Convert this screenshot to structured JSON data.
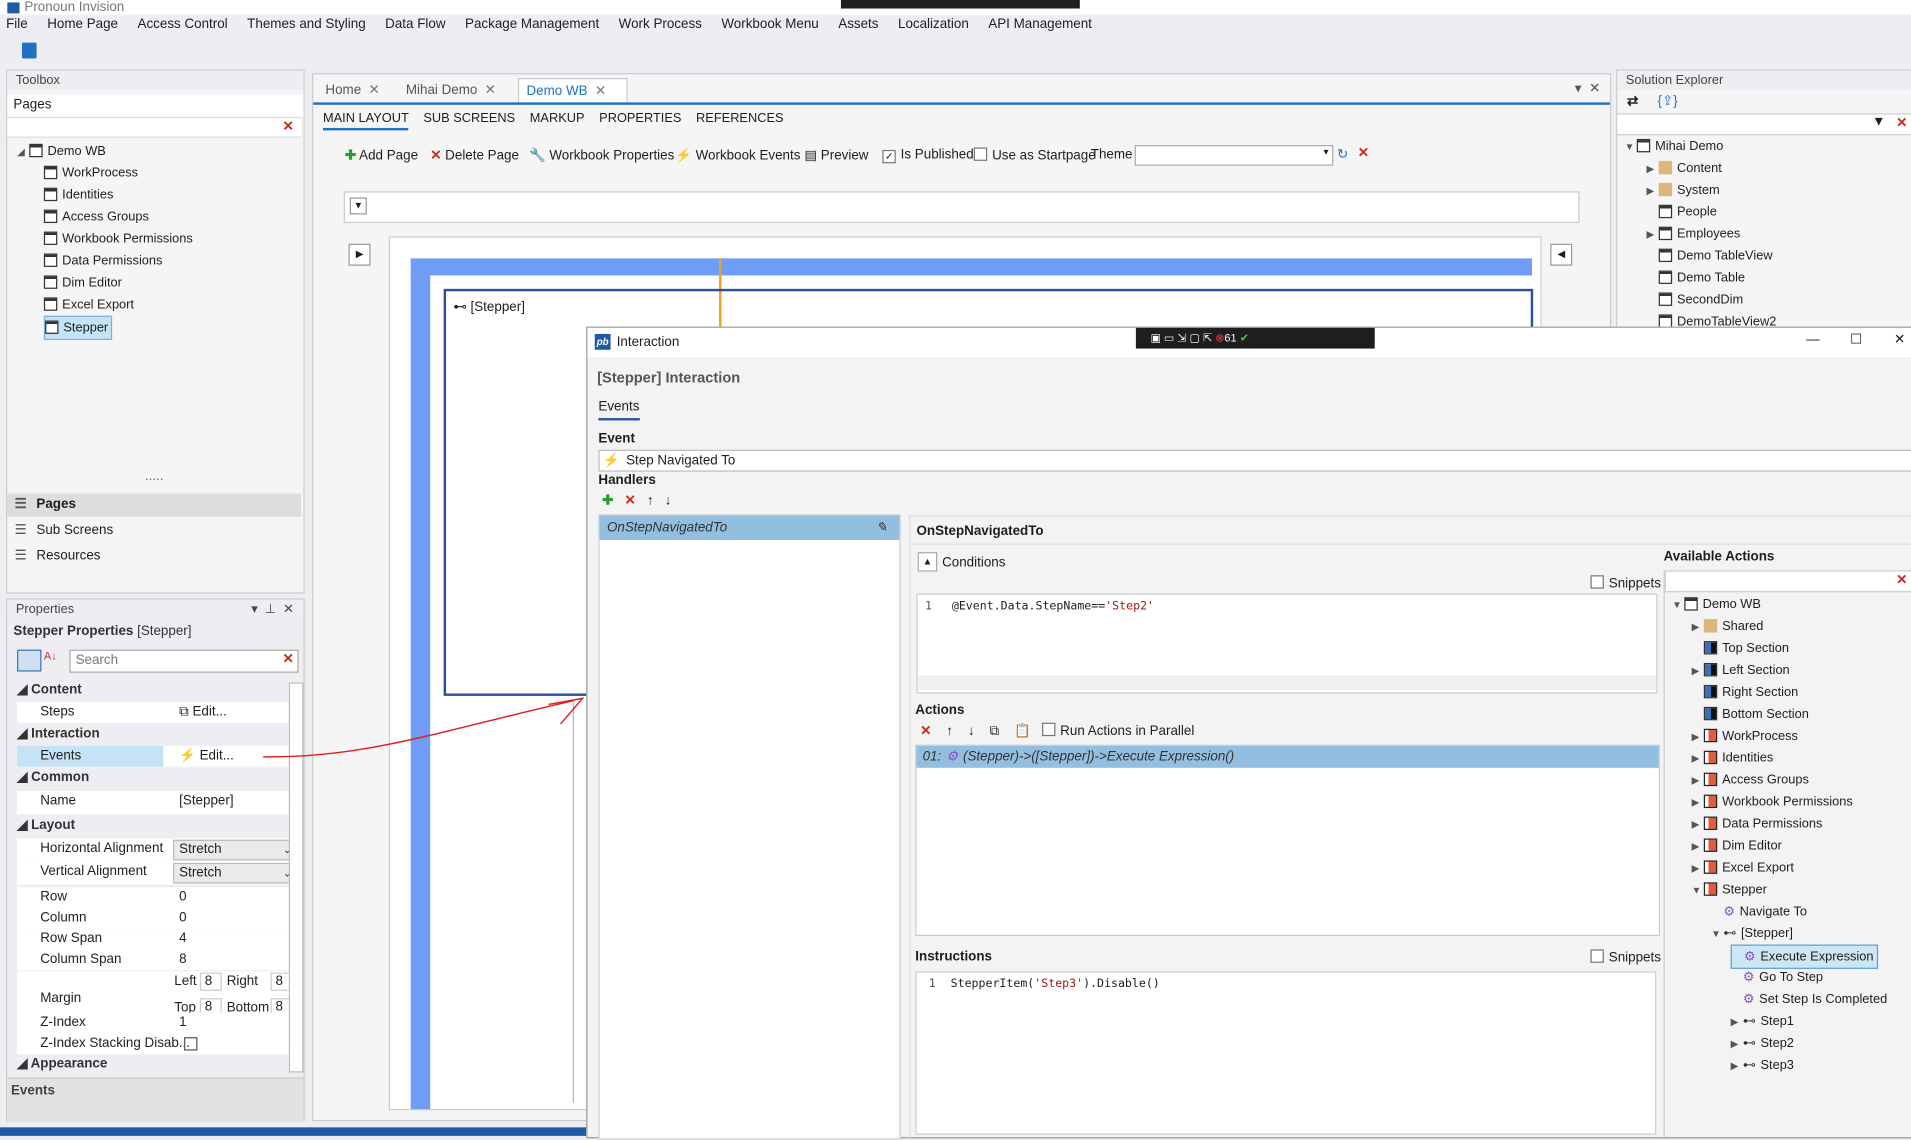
{
  "app": {
    "title": "Pronoun Invision"
  },
  "menu": [
    "File",
    "Home Page",
    "Access Control",
    "Themes and Styling",
    "Data Flow",
    "Package Management",
    "Work Process",
    "Workbook Menu",
    "Assets",
    "Localization",
    "API Management"
  ],
  "toolbox": {
    "title": "Toolbox",
    "section": "Pages",
    "tree": [
      {
        "label": "Demo WB",
        "level": 0,
        "icon": "book"
      },
      {
        "label": "WorkProcess",
        "level": 1,
        "icon": "page"
      },
      {
        "label": "Identities",
        "level": 1,
        "icon": "page"
      },
      {
        "label": "Access Groups",
        "level": 1,
        "icon": "page"
      },
      {
        "label": "Workbook Permissions",
        "level": 1,
        "icon": "page"
      },
      {
        "label": "Data Permissions",
        "level": 1,
        "icon": "page"
      },
      {
        "label": "Dim Editor",
        "level": 1,
        "icon": "page"
      },
      {
        "label": "Excel Export",
        "level": 1,
        "icon": "page"
      },
      {
        "label": "Stepper",
        "level": 1,
        "icon": "page",
        "selected": true
      }
    ],
    "bottom_tabs": [
      "Pages",
      "Sub Screens",
      "Resources"
    ]
  },
  "properties": {
    "title": "Properties",
    "header_bold": "Stepper Properties",
    "header_name": "[Stepper]",
    "search_placeholder": "Search",
    "categories": {
      "content": "Content",
      "interaction": "Interaction",
      "common": "Common",
      "layout": "Layout",
      "appearance": "Appearance"
    },
    "steps": {
      "label": "Steps",
      "value": "Edit..."
    },
    "events": {
      "label": "Events",
      "value": "Edit..."
    },
    "name": {
      "label": "Name",
      "value": "[Stepper]"
    },
    "halign": {
      "label": "Horizontal Alignment",
      "value": "Stretch"
    },
    "valign": {
      "label": "Vertical Alignment",
      "value": "Stretch"
    },
    "row": {
      "label": "Row",
      "value": "0"
    },
    "column": {
      "label": "Column",
      "value": "0"
    },
    "rowspan": {
      "label": "Row Span",
      "value": "4"
    },
    "colspan": {
      "label": "Column Span",
      "value": "8"
    },
    "margin": {
      "label": "Margin",
      "left_label": "Left",
      "left": "8",
      "right_label": "Right",
      "right": "8",
      "top_label": "Top",
      "top": "8",
      "bottom_label": "Bottom",
      "bottom": "8"
    },
    "zindex": {
      "label": "Z-Index",
      "value": "1"
    },
    "zstack": {
      "label": "Z-Index Stacking Disab...",
      "checked": false
    },
    "footer": "Events"
  },
  "doc": {
    "tabs": [
      {
        "label": "Home"
      },
      {
        "label": "Mihai Demo"
      },
      {
        "label": "Demo WB",
        "active": true
      }
    ],
    "subtabs": [
      "MAIN LAYOUT",
      "SUB SCREENS",
      "MARKUP",
      "PROPERTIES",
      "REFERENCES"
    ],
    "toolbar": {
      "add_page": "Add Page",
      "delete_page": "Delete Page",
      "wb_properties": "Workbook Properties",
      "wb_events": "Workbook Events",
      "preview": "Preview",
      "is_published": "Is Published",
      "is_published_checked": true,
      "startpage": "Use as Startpage",
      "startpage_checked": false,
      "theme_label": "Theme",
      "theme_value": ""
    },
    "stepper_label": "[Stepper]"
  },
  "solution": {
    "title": "Solution Explorer",
    "tree": [
      {
        "label": "Mihai Demo",
        "level": 0,
        "expanded": true
      },
      {
        "label": "Content",
        "level": 1,
        "expandable": true,
        "icon": "folder"
      },
      {
        "label": "System",
        "level": 1,
        "expandable": true,
        "icon": "folder"
      },
      {
        "label": "People",
        "level": 1
      },
      {
        "label": "Employees",
        "level": 1,
        "expandable": true
      },
      {
        "label": "Demo TableView",
        "level": 1
      },
      {
        "label": "Demo Table",
        "level": 1
      },
      {
        "label": "SecondDim",
        "level": 1
      },
      {
        "label": "DemoTableView2",
        "level": 1
      }
    ]
  },
  "dialog": {
    "title": "Interaction",
    "badge_count": "61",
    "heading": "[Stepper] Interaction",
    "tab": "Events",
    "event_label": "Event",
    "event_value": "Step Navigated To",
    "handlers_label": "Handlers",
    "handlers": [
      "OnStepNavigatedTo"
    ],
    "handler_title": "OnStepNavigatedTo",
    "conditions_label": "Conditions",
    "snippets": "Snippets",
    "condition_line": "1",
    "condition_code": "@Event.Data.StepName==",
    "condition_str": "'Step2'",
    "actions_label": "Actions",
    "run_parallel": "Run Actions in Parallel",
    "actions": [
      {
        "index": "01:",
        "text": "(Stepper)->([Stepper])->Execute Expression()"
      }
    ],
    "instructions_label": "Instructions",
    "instr_line": "1",
    "instr_code": "StepperItem(",
    "instr_str": "'Step3'",
    "instr_code2": ").Disable()",
    "available_title": "Available Actions",
    "available": [
      {
        "label": "Demo WB",
        "level": 0,
        "icon": "book",
        "exp": "down"
      },
      {
        "label": "Shared",
        "level": 1,
        "icon": "folder",
        "exp": "right"
      },
      {
        "label": "Top Section",
        "level": 1,
        "icon": "blue"
      },
      {
        "label": "Left Section",
        "level": 1,
        "icon": "blue",
        "exp": "right"
      },
      {
        "label": "Right Section",
        "level": 1,
        "icon": "blue"
      },
      {
        "label": "Bottom Section",
        "level": 1,
        "icon": "blue"
      },
      {
        "label": "WorkProcess",
        "level": 1,
        "icon": "red",
        "exp": "right"
      },
      {
        "label": "Identities",
        "level": 1,
        "icon": "red",
        "exp": "right"
      },
      {
        "label": "Access Groups",
        "level": 1,
        "icon": "red",
        "exp": "right"
      },
      {
        "label": "Workbook Permissions",
        "level": 1,
        "icon": "red",
        "exp": "right"
      },
      {
        "label": "Data Permissions",
        "level": 1,
        "icon": "red",
        "exp": "right"
      },
      {
        "label": "Dim Editor",
        "level": 1,
        "icon": "red",
        "exp": "right"
      },
      {
        "label": "Excel Export",
        "level": 1,
        "icon": "red",
        "exp": "right"
      },
      {
        "label": "Stepper",
        "level": 1,
        "icon": "red",
        "exp": "down"
      },
      {
        "label": "Navigate To",
        "level": 2,
        "icon": "action"
      },
      {
        "label": "[Stepper]",
        "level": 2,
        "icon": "stepper",
        "exp": "down"
      },
      {
        "label": "Execute Expression",
        "level": 3,
        "icon": "action",
        "selected": true
      },
      {
        "label": "Go To Step",
        "level": 3,
        "icon": "action"
      },
      {
        "label": "Set Step Is Completed",
        "level": 3,
        "icon": "action"
      },
      {
        "label": "Step1",
        "level": 3,
        "icon": "stepper",
        "exp": "right"
      },
      {
        "label": "Step2",
        "level": 3,
        "icon": "stepper",
        "exp": "right"
      },
      {
        "label": "Step3",
        "level": 3,
        "icon": "stepper",
        "exp": "right"
      }
    ]
  },
  "colors": {
    "accent": "#1e72c4",
    "selection": "#92bfe0",
    "designer_blue": "#6f9cf5",
    "annotation": "#e02020"
  }
}
